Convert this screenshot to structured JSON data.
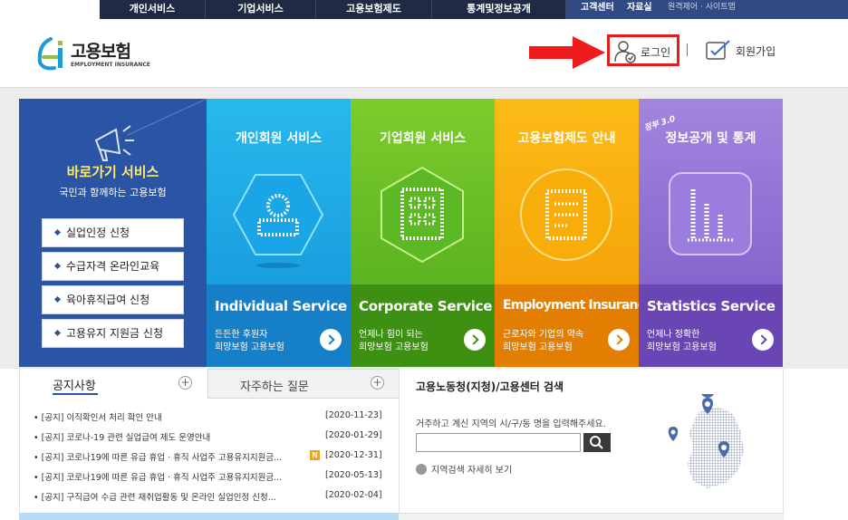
{
  "topnav": {
    "items": [
      "개인서비스",
      "기업서비스",
      "고용보험제도",
      "통계및정보공개"
    ],
    "util": [
      "고객센터",
      "자료실"
    ],
    "util_small": "원격제어 · 사이트맵"
  },
  "header": {
    "logo_ko": "고용보험",
    "logo_en": "EMPLOYMENT INSURANCE",
    "login": "로그인",
    "join": "회원가입"
  },
  "quick": {
    "title": "바로가기 서비스",
    "subtitle": "국민과 함께하는 고용보험",
    "buttons": [
      "실업인정 신청",
      "수급자격 온라인교육",
      "육아휴직급여 신청",
      "고용유지 지원금 신청"
    ]
  },
  "cards": [
    {
      "title": "개인회원 서비스",
      "en": "Individual Service",
      "d1": "든든한 후원자",
      "d2": "희망보험 고용보험"
    },
    {
      "title": "기업회원 서비스",
      "en": "Corporate Service",
      "d1": "언제나 힘이 되는",
      "d2": "희망보험 고용보험"
    },
    {
      "title": "고용보험제도 안내",
      "en": "Employment Insurance",
      "d1": "근로자와 기업의 약속",
      "d2": "희망보험 고용보험"
    },
    {
      "title": "정보공개 및 통계",
      "en": "Statistics Service",
      "d1": "언제나 정확한",
      "d2": "희망보험 고용보험",
      "badge": "정부 3.0"
    }
  ],
  "news": {
    "tab1": "공지사항",
    "tab2": "자주하는 질문",
    "rows": [
      {
        "t": "• [공지] 이직확인서 처리 확인 안내",
        "d": "[2020-11-23]"
      },
      {
        "t": "• [공지] 코로나-19 관련 실업급여 제도 운영안내",
        "d": "[2020-01-29]"
      },
      {
        "t": "• [공지] 코로나19에 따른 유급 휴업 · 휴직 사업주 고용유지지원금...",
        "d": "[2020-12-31]",
        "new": "N"
      },
      {
        "t": "• [공지] 코로나19에 따른 유급 휴업 · 휴직 사업주 고용유지지원금...",
        "d": "[2020-05-13]"
      },
      {
        "t": "• [공지] 구직급여 수급 관련 재취업활동 및 온라인 실업인정 신청...",
        "d": "[2020-02-04]"
      }
    ]
  },
  "search": {
    "title": "고용노동청(지청)/고용센터 검색",
    "desc": "거주하고 계신 지역의 시/구/동 명을 입력해주세요.",
    "more": "지역검색 자세히 보기"
  }
}
